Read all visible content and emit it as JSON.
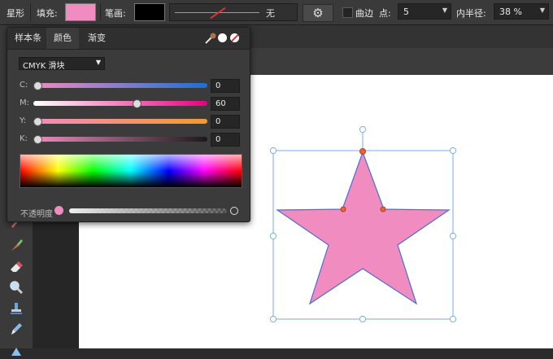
{
  "toolbar": {
    "shape_label": "星形",
    "fill_label": "填充:",
    "fill_color": "#f08cbf",
    "stroke_label": "笔画:",
    "stroke_color": "#000000",
    "stroke_width_value": "无",
    "settings_icon": "gear-icon",
    "curve_label": "曲边",
    "points_label": "点:",
    "points_value": "5",
    "inner_radius_label": "内半径:",
    "inner_radius_value": "38 %"
  },
  "color_panel": {
    "tabs": [
      "样本条",
      "颜色",
      "渐变"
    ],
    "active_tab": "颜色",
    "mode_select": "CMYK 滑块",
    "channels": [
      {
        "label": "C:",
        "value": "0"
      },
      {
        "label": "M:",
        "value": "60"
      },
      {
        "label": "Y:",
        "value": "0"
      },
      {
        "label": "K:",
        "value": "0"
      }
    ],
    "opacity_label": "不透明度",
    "opacity_value": 1.0,
    "current_color": "#f08cbf"
  },
  "canvas": {
    "shape": "star",
    "shape_fill": "#f08cbf",
    "shape_stroke": "#4a6fd4",
    "selection_color": "#7aaee0",
    "handle_color": "#e8643c"
  },
  "tools": [
    "pencil-icon",
    "paint-brush-icon",
    "eraser-icon",
    "zoom-icon",
    "stamp-icon",
    "pen-icon"
  ]
}
